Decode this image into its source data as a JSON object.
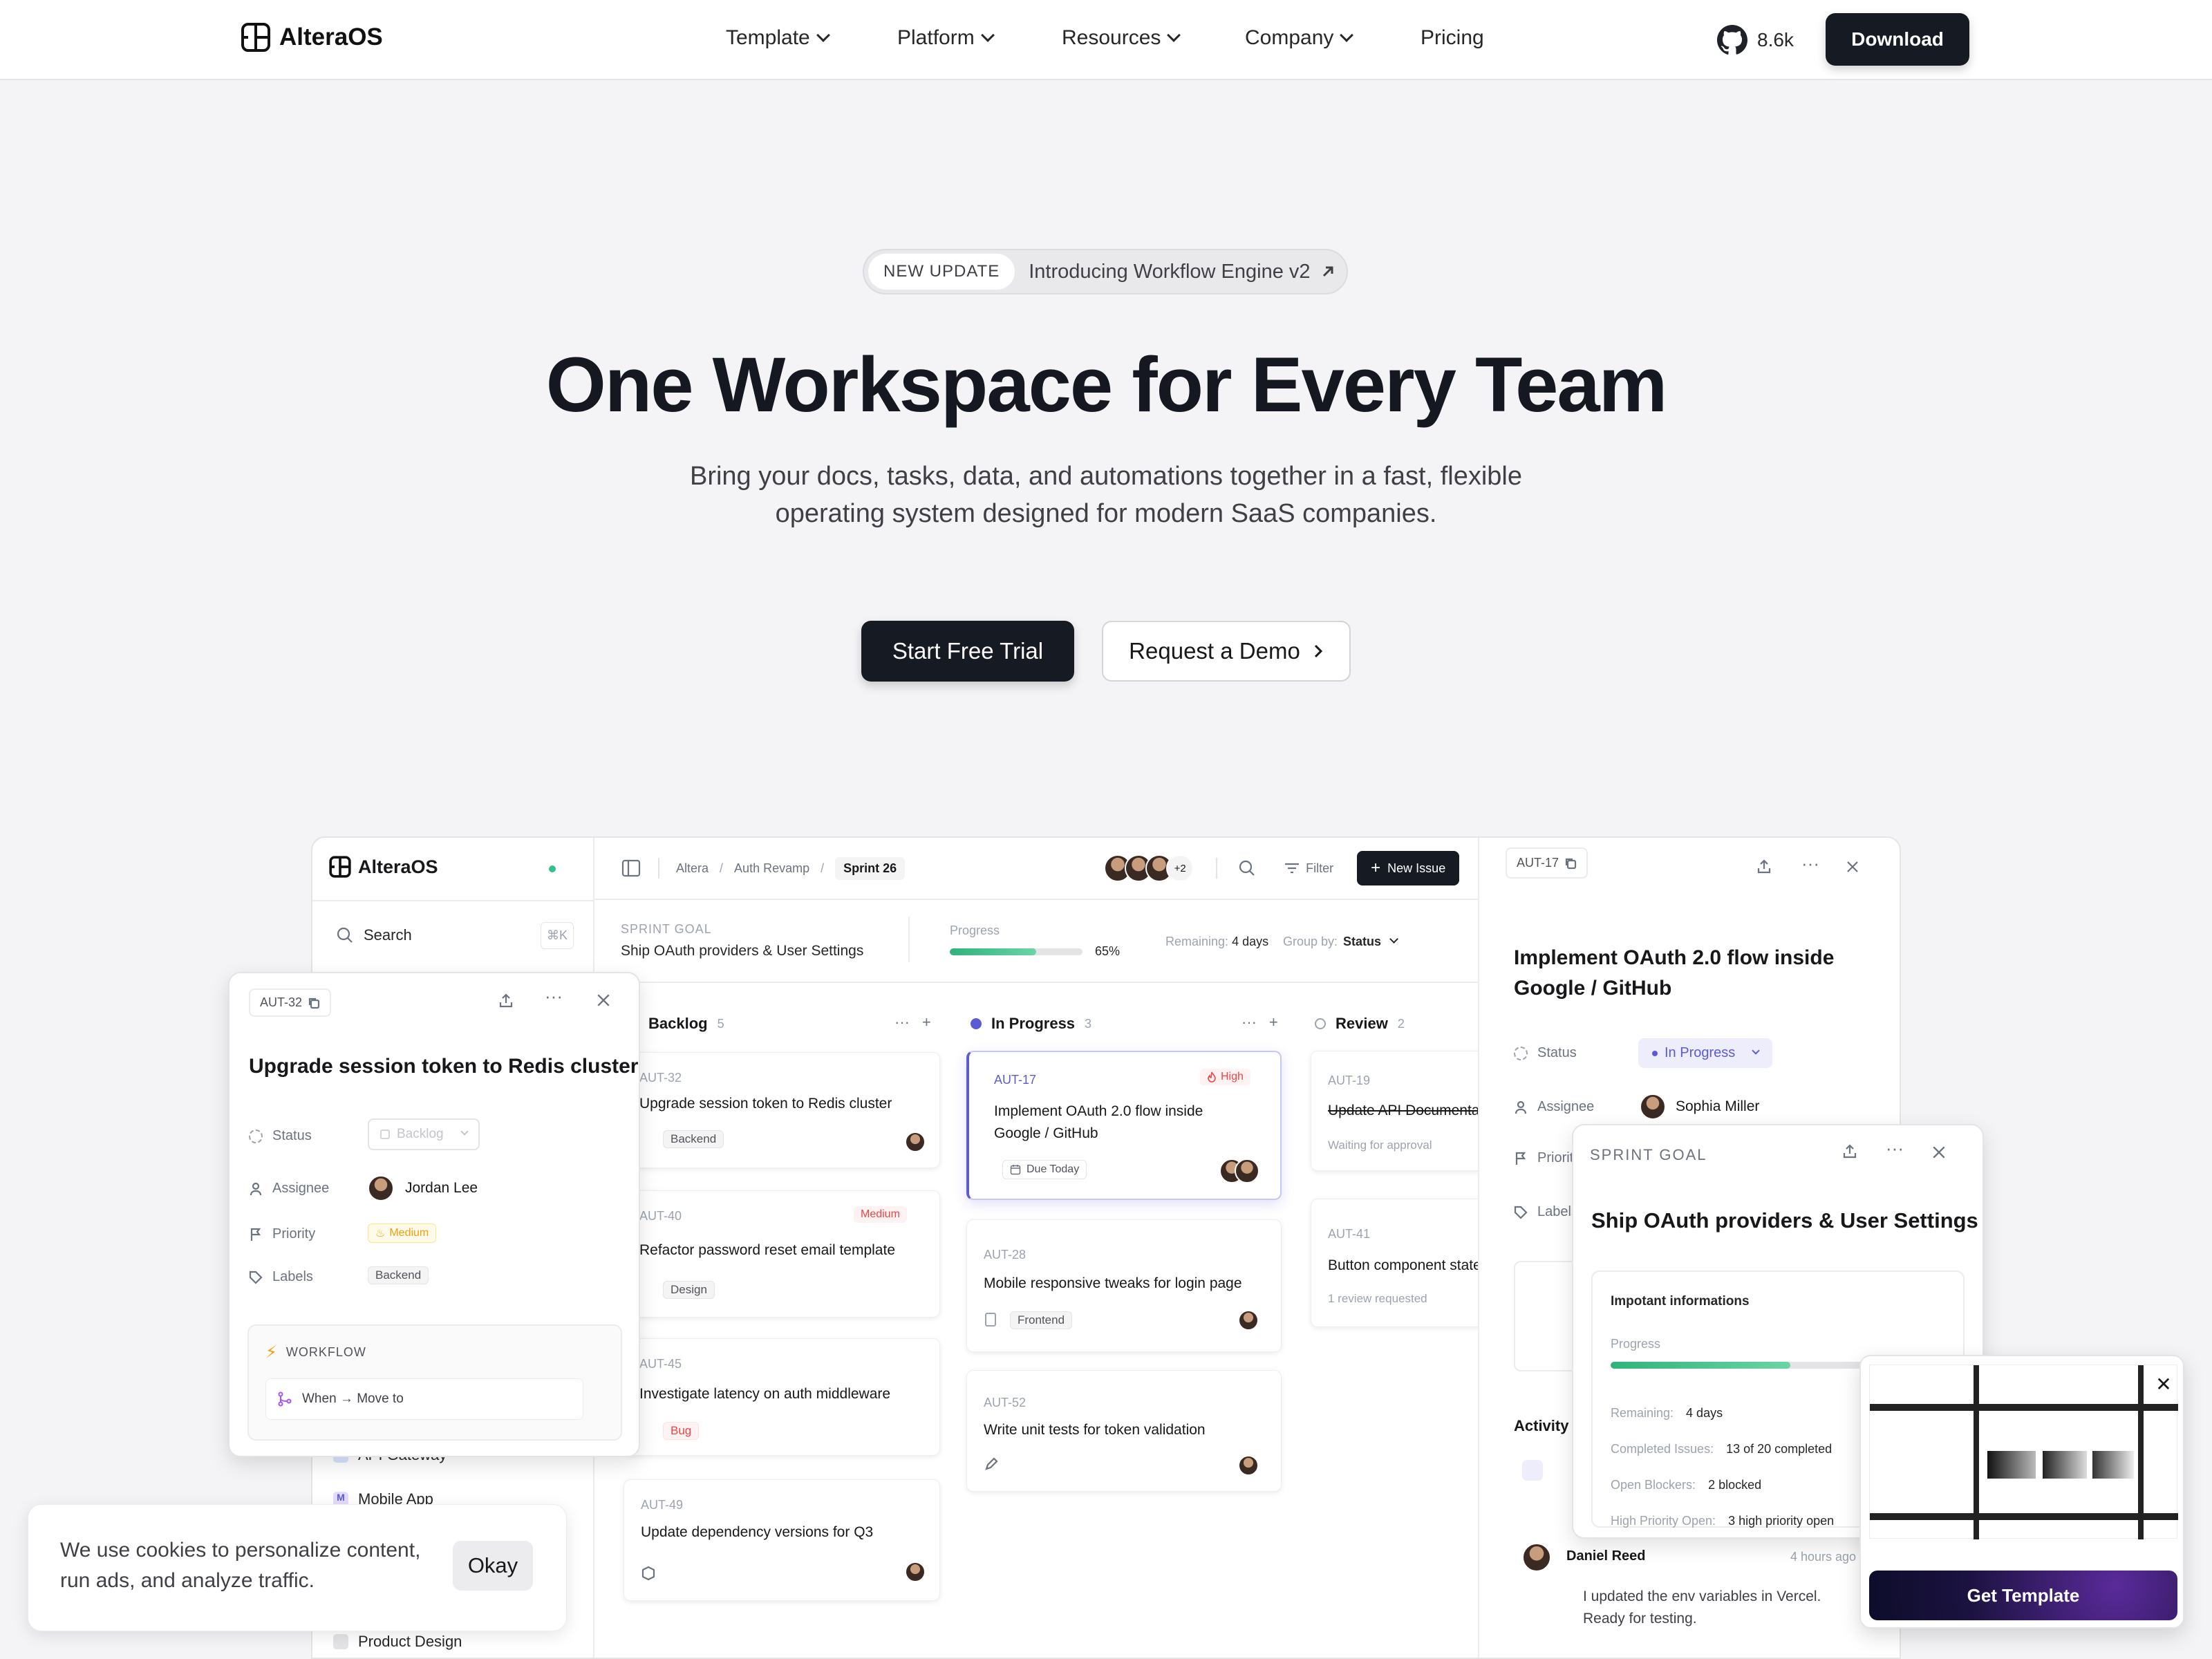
{
  "header": {
    "brand": "AlteraOS",
    "nav": [
      "Template",
      "Platform",
      "Resources",
      "Company"
    ],
    "pricing": "Pricing",
    "stars": "8.6k",
    "download": "Download"
  },
  "hero": {
    "badge": "NEW UPDATE",
    "announcement": "Introducing Workflow Engine v2",
    "title": "One Workspace for Every Team",
    "subtitle_1": "Bring your docs, tasks, data, and automations together in a fast, flexible",
    "subtitle_2": "operating system designed for modern SaaS companies.",
    "cta_primary": "Start Free Trial",
    "cta_secondary": "Request a Demo"
  },
  "sidebar": {
    "brand": "AlteraOS",
    "search": "Search",
    "shortcut": "⌘K",
    "items": [
      "API Gateway",
      "Mobile App",
      "Product Design"
    ]
  },
  "board": {
    "breadcrumb": [
      "Altera",
      "Auth Revamp",
      "Sprint 26"
    ],
    "avatars_more": "+2",
    "filter": "Filter",
    "new_issue": "New Issue",
    "goal_label": "SPRINT GOAL",
    "goal": "Ship OAuth providers & User Settings",
    "progress_label": "Progress",
    "progress": 0.65,
    "progress_text": "65%",
    "remaining_label": "Remaining:",
    "remaining": "4 days",
    "group_label": "Group by:",
    "group": "Status",
    "columns": [
      {
        "name": "Backlog",
        "count": "5"
      },
      {
        "name": "In Progress",
        "count": "3"
      },
      {
        "name": "Review",
        "count": "2"
      }
    ],
    "backlog": [
      {
        "id": "AUT-32",
        "title": "Upgrade session token to Redis cluster",
        "tag": "Backend"
      },
      {
        "id": "AUT-40",
        "title": "Refactor password reset email template",
        "tag": "Design",
        "priority": "Medium"
      },
      {
        "id": "AUT-45",
        "title": "Investigate latency on auth middleware",
        "tag": "Bug"
      },
      {
        "id": "AUT-49",
        "title": "Update dependency versions for Q3"
      }
    ],
    "inprogress": [
      {
        "id": "AUT-17",
        "title": "Implement OAuth 2.0 flow inside Google / GitHub",
        "priority": "High",
        "due": "Due Today"
      },
      {
        "id": "AUT-28",
        "title": "Mobile responsive tweaks for login page",
        "tag": "Frontend"
      },
      {
        "id": "AUT-52",
        "title": "Write unit tests for token validation"
      }
    ],
    "review": [
      {
        "id": "AUT-19",
        "title": "Update API Documentation",
        "note": "Waiting for approval"
      },
      {
        "id": "AUT-41",
        "title": "Button component states",
        "note": "1 review requested"
      }
    ]
  },
  "detail": {
    "id": "AUT-17",
    "title": "Implement OAuth 2.0 flow inside Google / GitHub",
    "status_label": "Status",
    "status": "In Progress",
    "assignee_label": "Assignee",
    "assignee": "Sophia Miller",
    "priority_label": "Priority",
    "labels_label": "Labels",
    "activity": "Activity",
    "comment_author": "Daniel Reed",
    "comment_time": "4 hours ago",
    "comment": "I updated the env variables in Vercel. Ready for testing."
  },
  "float_left": {
    "id": "AUT-32",
    "title": "Upgrade session token to Redis cluster",
    "status_label": "Status",
    "status": "Backlog",
    "assignee_label": "Assignee",
    "assignee": "Jordan Lee",
    "priority_label": "Priority",
    "priority": "Medium",
    "labels_label": "Labels",
    "label": "Backend",
    "workflow": "WORKFLOW",
    "rule": "When → Move to"
  },
  "float_goal": {
    "label": "SPRINT GOAL",
    "title": "Ship OAuth providers & User Settings",
    "info": "Impotant informations",
    "progress_label": "Progress",
    "progress": 0.65,
    "rows": [
      {
        "k": "Remaining:",
        "v": "4 days"
      },
      {
        "k": "Completed Issues:",
        "v": "13 of 20 completed"
      },
      {
        "k": "Open Blockers:",
        "v": "2 blocked"
      },
      {
        "k": "High Priority Open:",
        "v": "3 high priority open"
      }
    ]
  },
  "cookie": {
    "text_1": "We use cookies to personalize content,",
    "text_2": "run ads, and analyze traffic.",
    "ok": "Okay"
  },
  "template_promo": {
    "cta": "Get Template"
  },
  "colors": {
    "dark": "#161a22",
    "accent": "#5b5bd6",
    "green": "#34c08a",
    "orange": "#f59e0b",
    "red": "#ef4444"
  }
}
